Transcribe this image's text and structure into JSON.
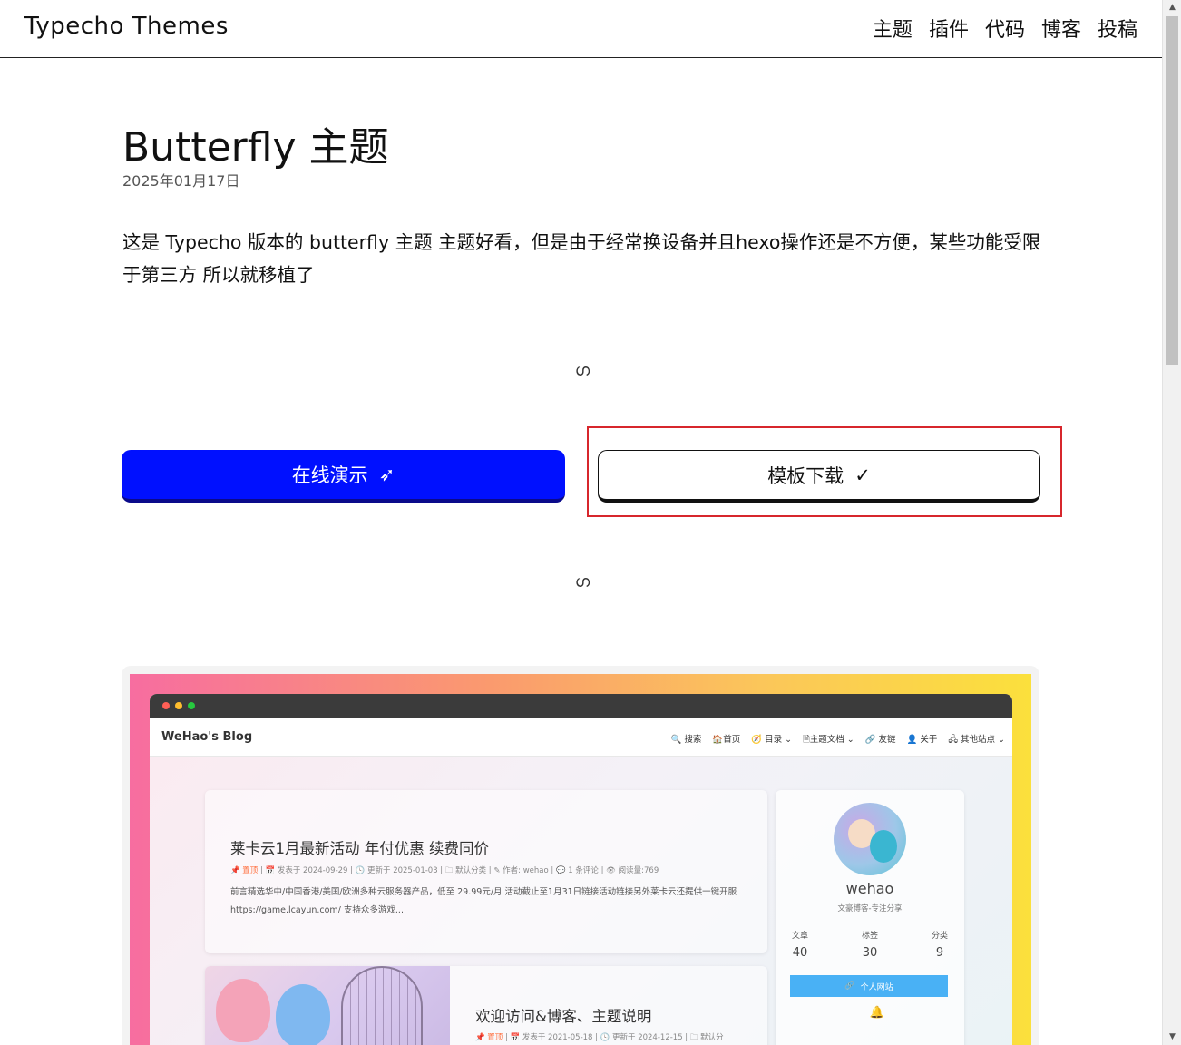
{
  "header": {
    "brand": "Typecho Themes",
    "nav": [
      "主题",
      "插件",
      "代码",
      "博客",
      "投稿"
    ]
  },
  "article": {
    "title": "Butterfly 主题",
    "date": "2025年01月17日",
    "description": "这是 Typecho 版本的 butterfly 主题 主题好看，但是由于经常换设备并且hexo操作还是不方便，某些功能受限于第三方 所以就移植了",
    "divider_glyph": "ഗ"
  },
  "buttons": {
    "demo_label": "在线演示",
    "demo_icon": "➶",
    "download_label": "模板下载",
    "download_icon": "✓"
  },
  "preview": {
    "blog_name": "WeHao's Blog",
    "menu": [
      "🔍 搜索",
      "🏠首页",
      "🧭 目录 ⌄",
      "🗎主题文档 ⌄",
      "🔗 友链",
      "👤 关于",
      "🖧 其他站点 ⌄"
    ],
    "post1": {
      "title": "莱卡云1月最新活动 年付优惠 续费同价",
      "pin": "📌 置顶",
      "meta": "| 📅 发表于  2024-09-29  |  🕓 更新于  2025-01-03  |  🗀 默认分类  |  ✎ 作者: wehao  |  💬 1 条评论  |  👁 阅读量:769",
      "excerpt": "前言精选华中/中国香港/美国/欧洲多种云服务器产品，低至 29.99元/月 活动截止至1月31日链接活动链接另外莱卡云还提供一键开服 https://game.lcayun.com/ 支持众多游戏..."
    },
    "post2": {
      "title": "欢迎访问&博客、主题说明",
      "pin": "📌 置顶",
      "meta": "| 📅 发表于  2021-05-18  |  🕓 更新于  2024-12-15  |  🗀 默认分"
    },
    "profile": {
      "name": "wehao",
      "subtitle": "文豪博客-专注分享",
      "stats": [
        {
          "label": "文章",
          "value": "40"
        },
        {
          "label": "标签",
          "value": "30"
        },
        {
          "label": "分类",
          "value": "9"
        }
      ],
      "site_button": "个人网站",
      "site_icon": "🔗",
      "social_icons": [
        "",
        "🔔"
      ]
    }
  },
  "colors": {
    "demo_button": "#0010ff",
    "highlight_border": "#d7262c",
    "site_button": "#49b1f5"
  }
}
